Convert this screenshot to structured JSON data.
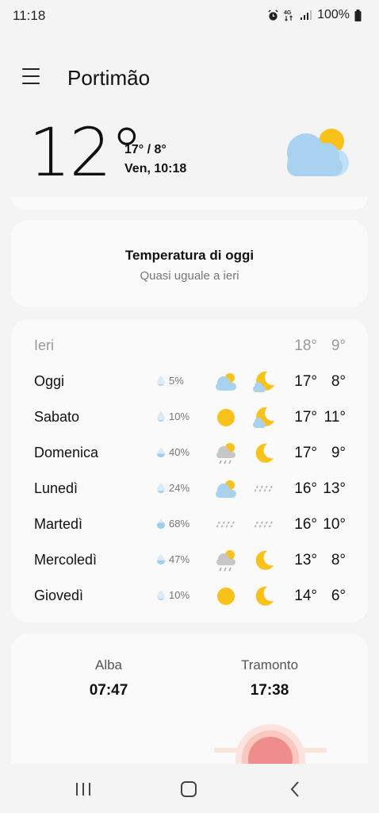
{
  "status": {
    "time": "11:18",
    "battery": "100%",
    "network": "4G"
  },
  "header": {
    "city": "Portimão",
    "menu_icon": "hamburger-menu-icon"
  },
  "current": {
    "temp": "12°",
    "hilo": "17° / 8°",
    "datetime": "Ven, 10:18",
    "icon": "partly-cloudy-icon"
  },
  "today_card": {
    "title": "Temperatura di oggi",
    "subtitle": "Quasi uguale a ieri"
  },
  "forecast": [
    {
      "day": "Ieri",
      "precip": "",
      "day_icon": "",
      "night_icon": "",
      "hi": "18°",
      "lo": "9°",
      "muted": true
    },
    {
      "day": "Oggi",
      "precip": "5%",
      "day_icon": "partly-cloudy-icon",
      "night_icon": "moon-cloud-icon",
      "hi": "17°",
      "lo": "8°"
    },
    {
      "day": "Sabato",
      "precip": "10%",
      "day_icon": "sun-icon",
      "night_icon": "moon-cloud-icon",
      "hi": "17°",
      "lo": "11°"
    },
    {
      "day": "Domenica",
      "precip": "40%",
      "day_icon": "sun-rain-icon",
      "night_icon": "moon-icon",
      "hi": "17°",
      "lo": "9°"
    },
    {
      "day": "Lunedì",
      "precip": "24%",
      "day_icon": "partly-cloudy-icon",
      "night_icon": "rain-icon",
      "hi": "16°",
      "lo": "13°"
    },
    {
      "day": "Martedì",
      "precip": "68%",
      "day_icon": "rain-icon",
      "night_icon": "rain-icon",
      "hi": "16°",
      "lo": "10°"
    },
    {
      "day": "Mercoledì",
      "precip": "47%",
      "day_icon": "sun-rain-icon",
      "night_icon": "moon-icon",
      "hi": "13°",
      "lo": "8°"
    },
    {
      "day": "Giovedì",
      "precip": "10%",
      "day_icon": "sun-icon",
      "night_icon": "moon-icon",
      "hi": "14°",
      "lo": "6°"
    }
  ],
  "sun": {
    "sunrise_label": "Alba",
    "sunrise_time": "07:47",
    "sunset_label": "Tramonto",
    "sunset_time": "17:38"
  },
  "colors": {
    "sun": "#f9c21a",
    "cloud": "#a9d2f0",
    "drop": "#9fcdee",
    "sunset": "#ef8d8d"
  },
  "navbar": {
    "recent_icon": "recent-apps-icon",
    "home_icon": "home-icon",
    "back_icon": "back-icon"
  }
}
